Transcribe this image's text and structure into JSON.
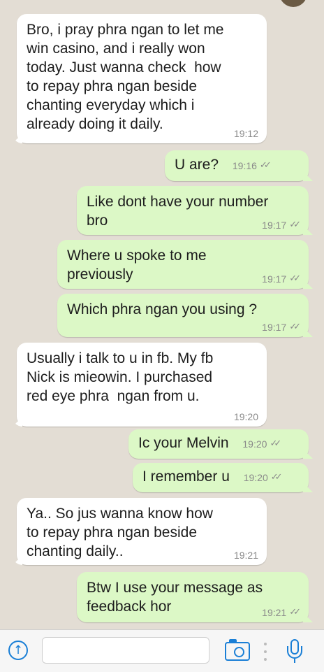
{
  "messages": [
    {
      "direction": "in",
      "text": "Bro, i pray phra ngan to let me\nwin casino, and i really won\ntoday. Just wanna check  how\nto repay phra ngan beside\nchanting everyday which i\nalready doing it daily.",
      "time": "19:12"
    },
    {
      "direction": "out",
      "text": "U are?",
      "time": "19:16",
      "status": "delivered"
    },
    {
      "direction": "out",
      "text": "Like dont have your number\nbro",
      "time": "19:17",
      "status": "delivered"
    },
    {
      "direction": "out",
      "text": "Where u spoke to me\npreviously",
      "time": "19:17",
      "status": "delivered"
    },
    {
      "direction": "out",
      "text": "Which phra ngan you using ?",
      "time": "19:17",
      "status": "delivered"
    },
    {
      "direction": "in",
      "text": "Usually i talk to u in fb. My fb\nNick is mieowin. I purchased\nred eye phra  ngan from u.",
      "time": "19:20"
    },
    {
      "direction": "out",
      "text": "Ic your Melvin",
      "time": "19:20",
      "status": "delivered"
    },
    {
      "direction": "out",
      "text": "I remember u",
      "time": "19:20",
      "status": "delivered"
    },
    {
      "direction": "in",
      "text": "Ya.. So jus wanna know how\nto repay phra ngan beside\nchanting daily..",
      "time": "19:21"
    },
    {
      "direction": "out",
      "text": "Btw I use your message as\nfeedback hor",
      "time": "19:21",
      "status": "delivered"
    }
  ],
  "status_icon": "double-check",
  "input_bar": {
    "message_value": "",
    "icons": [
      "upload-arrow-icon",
      "camera-icon",
      "microphone-icon"
    ]
  },
  "colors": {
    "background": "#e3ddd4",
    "incoming_bubble": "#ffffff",
    "outgoing_bubble": "#dcf8c6",
    "accent": "#1a7fd6"
  }
}
